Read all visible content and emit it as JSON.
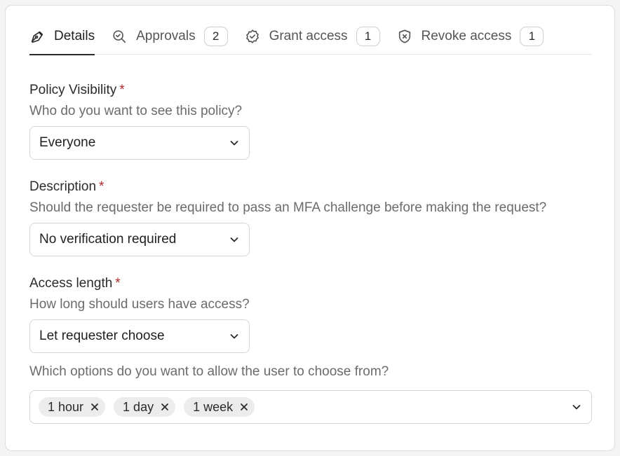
{
  "tabs": [
    {
      "label": "Details",
      "icon": "pen-tool-icon",
      "count": null,
      "active": true
    },
    {
      "label": "Approvals",
      "icon": "search-check-icon",
      "count": "2"
    },
    {
      "label": "Grant access",
      "icon": "badge-check-icon",
      "count": "1"
    },
    {
      "label": "Revoke access",
      "icon": "shield-x-icon",
      "count": "1"
    }
  ],
  "fields": {
    "visibility": {
      "label": "Policy Visibility",
      "required": "*",
      "help": "Who do you want to see this policy?",
      "value": "Everyone"
    },
    "description": {
      "label": "Description",
      "required": "*",
      "help": "Should the requester be required to pass an MFA challenge before making the request?",
      "value": "No verification required"
    },
    "access_length": {
      "label": "Access length",
      "required": "*",
      "help": "How long should users have access?",
      "value": "Let requester choose"
    },
    "options": {
      "help": "Which options do you want to allow the user to choose from?",
      "chips": [
        "1 hour",
        "1 day",
        "1 week"
      ]
    }
  },
  "colors": {
    "required": "#b3262c",
    "chip_bg": "#ececec",
    "border": "#d4d4d4"
  }
}
